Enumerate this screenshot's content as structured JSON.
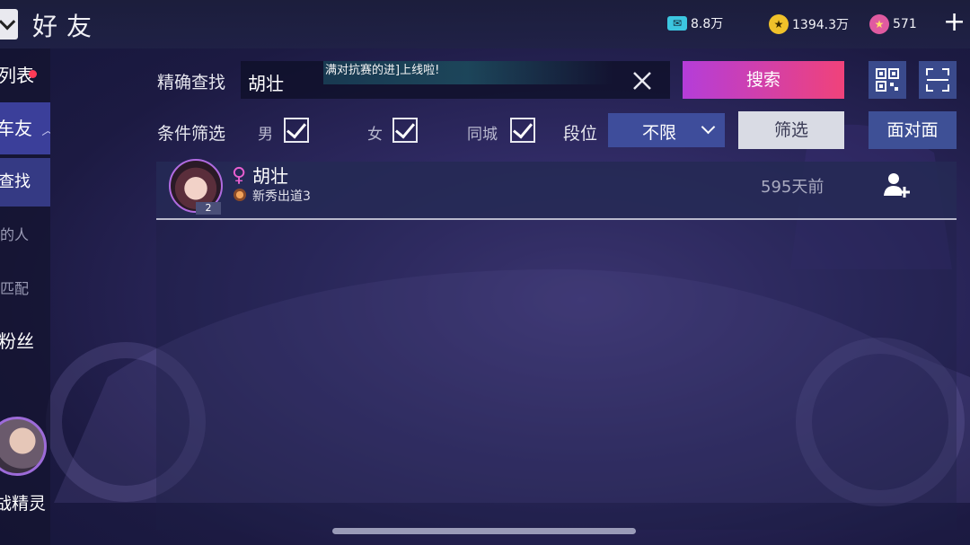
{
  "header": {
    "title": "好友",
    "currencies": [
      {
        "icon": "ticket-icon",
        "value": "8.8万",
        "color": "#3cc6e0"
      },
      {
        "icon": "gold-coin-icon",
        "value": "1394.3万",
        "color": "#f0c12a"
      },
      {
        "icon": "star-coin-icon",
        "value": "571",
        "color": "#e05aa0"
      }
    ],
    "plus_label": "+"
  },
  "sidebar": {
    "items": [
      {
        "label": "列表"
      },
      {
        "label": "车友"
      },
      {
        "label": "查找"
      },
      {
        "label": "的人"
      },
      {
        "label": "匹配"
      },
      {
        "label": "粉丝"
      },
      {
        "label": "战精灵"
      }
    ]
  },
  "search": {
    "label": "精确查找",
    "value": "胡壮",
    "toast": "满对抗赛的进]上线啦!",
    "button_label": "搜索"
  },
  "filter": {
    "label": "条件筛选",
    "male_label": "男",
    "female_label": "女",
    "same_city_label": "同城",
    "rank_label": "段位",
    "rank_value": "不限",
    "filter_button": "筛选",
    "face_to_face_button": "面对面"
  },
  "results": [
    {
      "name": "胡壮",
      "level": "2",
      "gender_symbol": "♀",
      "rank": "新秀出道3",
      "last_online": "595天前"
    }
  ],
  "colors": {
    "accent_pink": "#f0427a",
    "accent_purple": "#b43dd9",
    "panel_blue": "#3e4d9b"
  }
}
